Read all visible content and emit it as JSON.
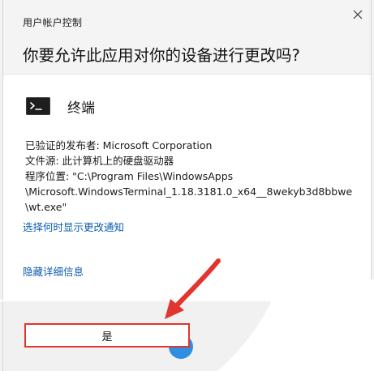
{
  "header": {
    "label": "用户帐户控制",
    "question": "你要允许此应用对你的设备进行更改吗?"
  },
  "app": {
    "icon": "terminal-icon",
    "name": "终端"
  },
  "details": {
    "publisher": "已验证的发布者: Microsoft Corporation",
    "file_origin": "文件源: 此计算机上的硬盘驱动器",
    "program_location_lines": [
      "程序位置: \"C:\\Program Files\\WindowsApps",
      "\\Microsoft.WindowsTerminal_1.18.3181.0_x64__8wekyb3d8bbwe",
      "\\wt.exe\""
    ]
  },
  "links": {
    "show_change_notice": "选择何时显示更改通知",
    "hide_details": "隐藏详细信息"
  },
  "buttons": {
    "yes": "是"
  },
  "annotation": {
    "arrow_color": "#e2352f",
    "highlight_color": "#e2352f"
  },
  "colors": {
    "link": "#0b5cad",
    "accent_blue": "#2f8fe0"
  }
}
